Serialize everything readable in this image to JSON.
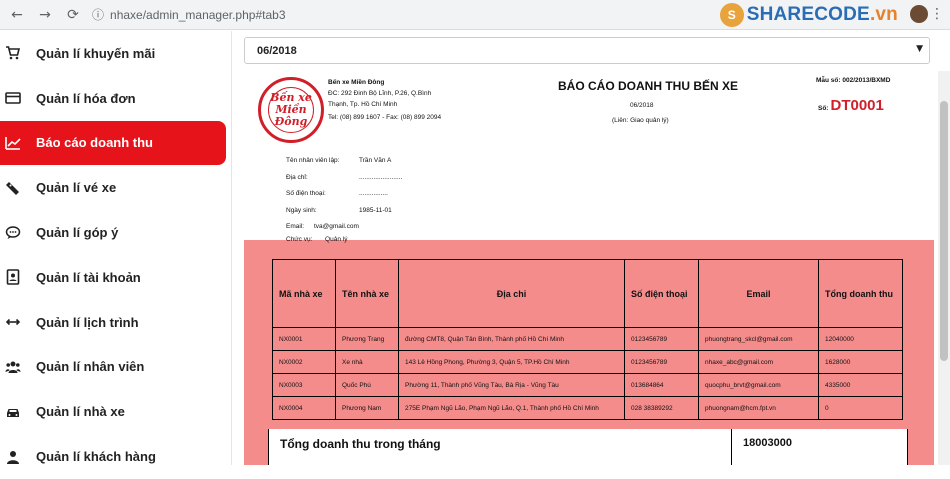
{
  "browser": {
    "url": "nhaxe/admin_manager.php#tab3",
    "logo_main": "SHARECODE",
    "logo_tld": ".vn"
  },
  "sidebar": {
    "items": [
      {
        "label": "Quản lí khuyến mãi",
        "icon": "cart-icon"
      },
      {
        "label": "Quản lí hóa đơn",
        "icon": "credit-card-icon"
      },
      {
        "label": "Báo cáo doanh thu",
        "icon": "line-chart-icon",
        "active": true
      },
      {
        "label": "Quản lí vé xe",
        "icon": "ticket-icon"
      },
      {
        "label": "Quản lí góp ý",
        "icon": "comment-icon"
      },
      {
        "label": "Quản lí tài khoản",
        "icon": "id-card-icon"
      },
      {
        "label": "Quản lí lịch trình",
        "icon": "arrows-horizontal-icon"
      },
      {
        "label": "Quản lí nhân viên",
        "icon": "users-icon"
      },
      {
        "label": "Quản lí nhà xe",
        "icon": "car-icon"
      },
      {
        "label": "Quản lí khách hàng",
        "icon": "user-icon"
      }
    ]
  },
  "filter": {
    "month": "06/2018"
  },
  "report": {
    "seal_text": "Bến xe Miền Đông",
    "company_name": "Bến xe Miền Đông",
    "company_address_1": "ĐC: 292 Đinh Bộ Lĩnh, P.26, Q.Bình",
    "company_address_2": "Thạnh, Tp. Hồ Chí Minh",
    "company_phone": "Tel: (08) 899 1607 - Fax: (08) 899 2094",
    "title": "BÁO CÁO DOANH THU BẾN XE",
    "month": "06/2018",
    "copy_note": "(Liên: Giao quản lý)",
    "form_no": "Mẫu số: 002/2013/BXMD",
    "no_label": "Số:",
    "no_value": "DT0001",
    "employee": [
      {
        "label": "Tên nhân viên lập:",
        "value": "Trần Văn A"
      },
      {
        "label": "Địa chỉ:",
        "value": "........................"
      },
      {
        "label": "Số điện thoại:",
        "value": "................"
      },
      {
        "label": "Ngày sinh:",
        "value": "1985-11-01"
      },
      {
        "label": "Email:",
        "value": "tva@gmail.com"
      }
    ],
    "position_label": "Chức vụ:",
    "position_value": "Quản lý",
    "columns": [
      "Mã nhà xe",
      "Tên nhà xe",
      "Địa chỉ",
      "Số điện thoại",
      "Email",
      "Tổng doanh thu"
    ],
    "rows": [
      {
        "id": "NX0001",
        "name": "Phương Trang",
        "address": "đường CMT8, Quận Tân Bình, Thành phố Hồ Chí Minh",
        "phone": "0123456789",
        "email": "phuongtrang_skcl@gmail.com",
        "total": "12040000"
      },
      {
        "id": "NX0002",
        "name": "Xe nhà",
        "address": "143 Lê Hồng Phong, Phường 3, Quận 5, TP.Hồ Chí Minh",
        "phone": "0123456789",
        "email": "nhaxe_abc@gmail.com",
        "total": "1628000"
      },
      {
        "id": "NX0003",
        "name": "Quốc Phú",
        "address": "Phường 11, Thành phố Vũng Tàu, Bà Rịa - Vũng Tàu",
        "phone": "013684864",
        "email": "quocphu_brvt@gmail.com",
        "total": "4335000"
      },
      {
        "id": "NX0004",
        "name": "Phương Nam",
        "address": "275E Phạm Ngũ Lão, Phạm Ngũ Lão, Q.1, Thành phố Hồ Chí Minh",
        "phone": "028 38389292",
        "email": "phuongnam@hcm.fpt.vn",
        "total": "0"
      }
    ],
    "grand_total_label": "Tổng doanh thu trong tháng",
    "grand_total_value": "18003000"
  }
}
